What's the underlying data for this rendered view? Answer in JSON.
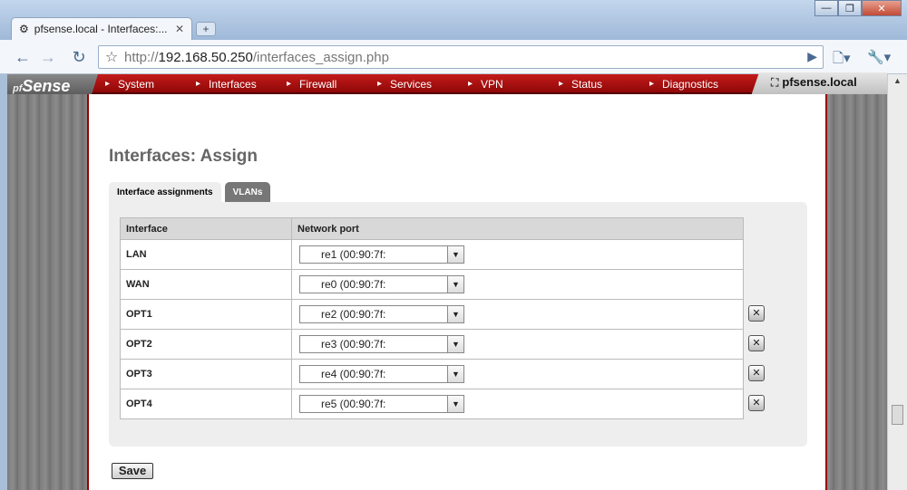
{
  "browser": {
    "tab_title": "pfsense.local - Interfaces:...",
    "tab_close": "✕",
    "new_tab": "+",
    "url_scheme": "http://",
    "url_host": "192.168.50.250",
    "url_path": "/interfaces_assign.php",
    "window_buttons": {
      "minimize": "—",
      "maximize": "❐",
      "close": "✕"
    }
  },
  "nav": {
    "logo": "Sense",
    "logo_prefix": "pf",
    "menu": [
      "System",
      "Interfaces",
      "Firewall",
      "Services",
      "VPN",
      "Status",
      "Diagnostics"
    ],
    "hostname": "pfsense.local"
  },
  "page": {
    "title": "Interfaces: Assign",
    "tabs": [
      {
        "label": "Interface assignments",
        "active": true
      },
      {
        "label": "VLANs",
        "active": false
      }
    ],
    "table": {
      "headers": [
        "Interface",
        "Network port"
      ],
      "rows": [
        {
          "interface": "LAN",
          "port": "re1 (00:90:7f:",
          "deletable": false
        },
        {
          "interface": "WAN",
          "port": "re0 (00:90:7f:",
          "deletable": false
        },
        {
          "interface": "OPT1",
          "port": "re2 (00:90:7f:",
          "deletable": true
        },
        {
          "interface": "OPT2",
          "port": "re3 (00:90:7f:",
          "deletable": true
        },
        {
          "interface": "OPT3",
          "port": "re4 (00:90:7f:",
          "deletable": true
        },
        {
          "interface": "OPT4",
          "port": "re5 (00:90:7f:",
          "deletable": true
        }
      ]
    },
    "save_label": "Save"
  },
  "colors": {
    "nav_red": "#b01010",
    "page_border": "#900000",
    "panel_bg": "#eeeeee"
  }
}
